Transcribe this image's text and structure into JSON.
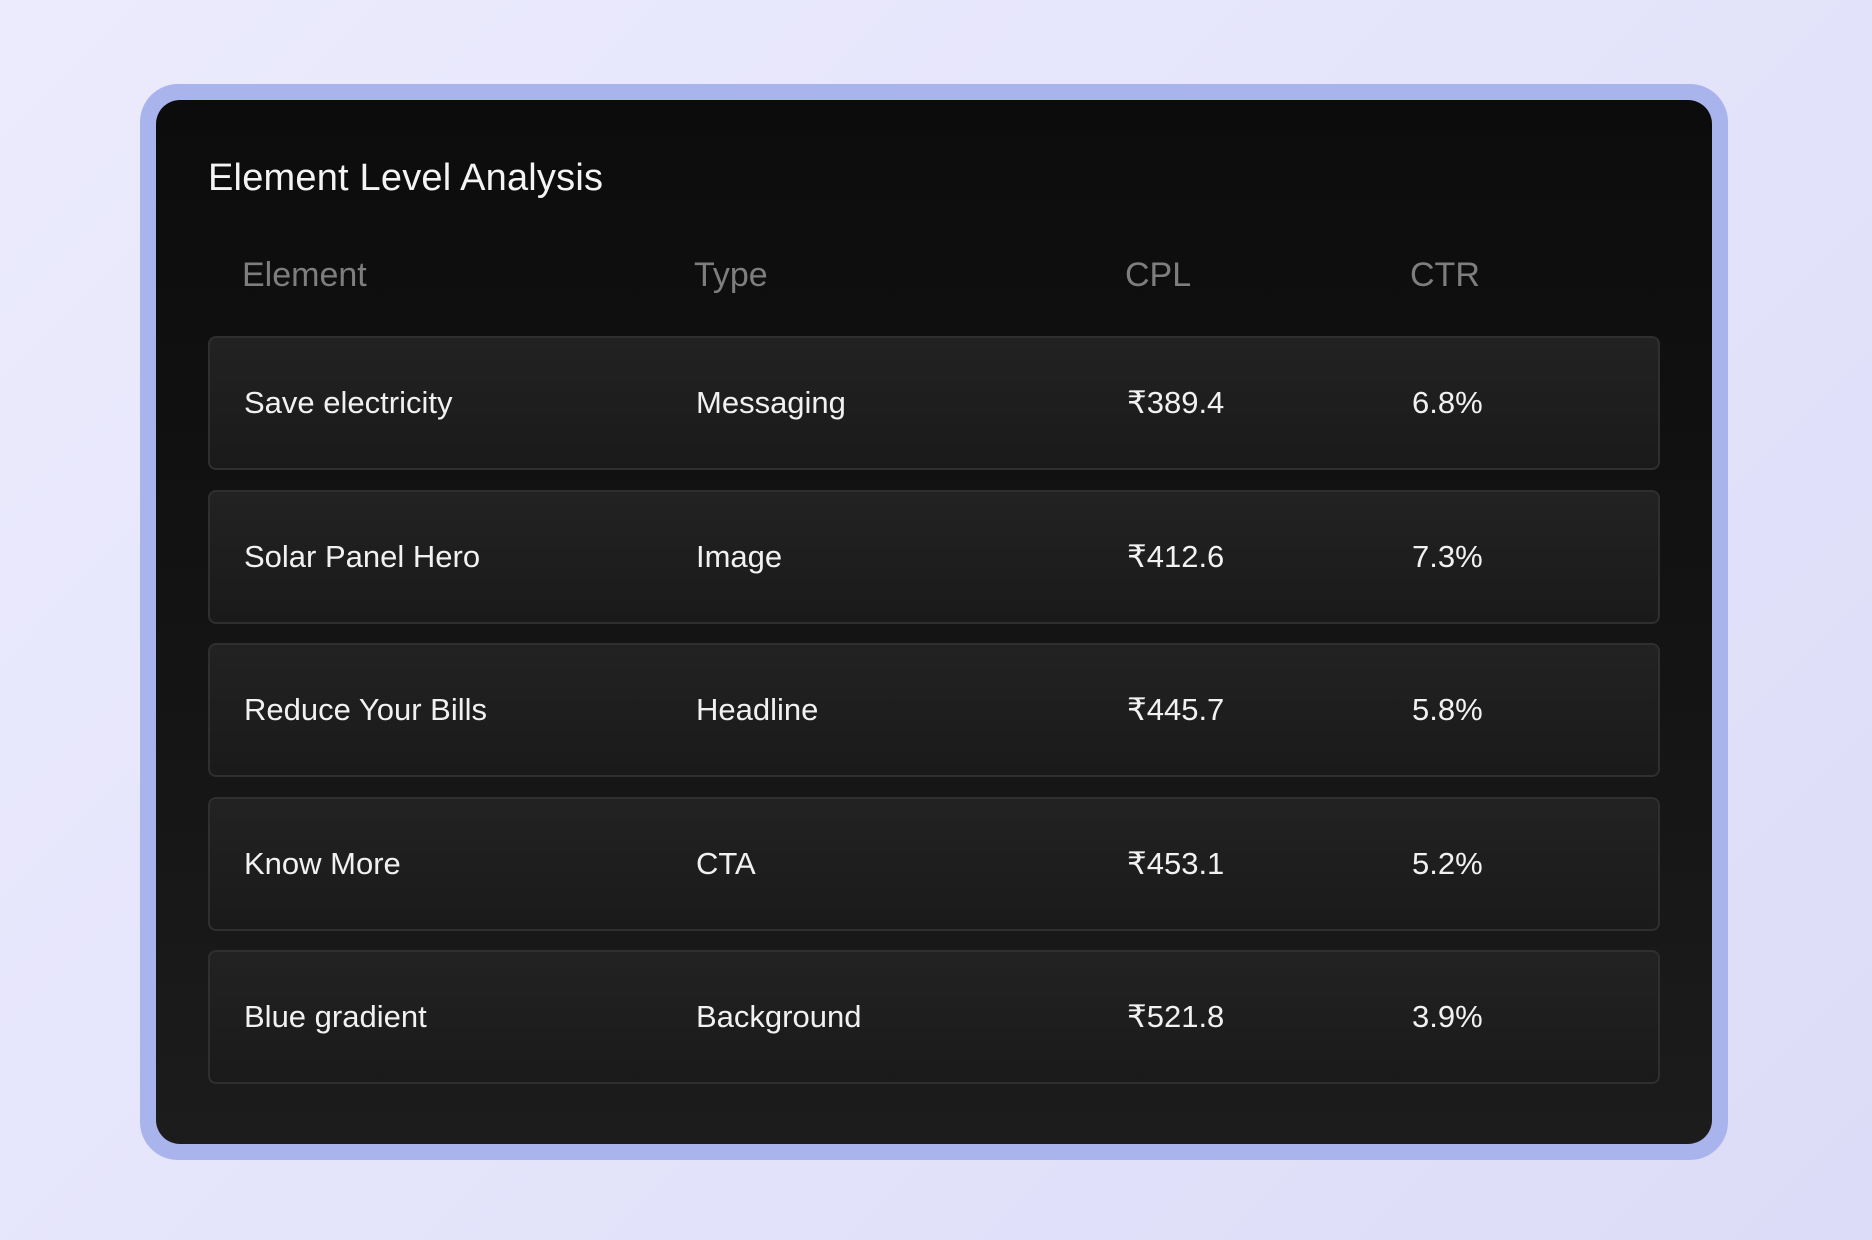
{
  "card": {
    "title": "Element Level Analysis"
  },
  "table": {
    "headers": {
      "element": "Element",
      "type": "Type",
      "cpl": "CPL",
      "ctr": "CTR"
    },
    "rows": [
      {
        "element": "Save electricity",
        "type": "Messaging",
        "cpl": "₹389.4",
        "ctr": "6.8%"
      },
      {
        "element": "Solar Panel Hero",
        "type": "Image",
        "cpl": "₹412.6",
        "ctr": "7.3%"
      },
      {
        "element": "Reduce Your Bills",
        "type": "Headline",
        "cpl": "₹445.7",
        "ctr": "5.8%"
      },
      {
        "element": "Know More",
        "type": "CTA",
        "cpl": "₹453.1",
        "ctr": "5.2%"
      },
      {
        "element": "Blue gradient",
        "type": "Background",
        "cpl": "₹521.8",
        "ctr": "3.9%"
      }
    ]
  },
  "colors": {
    "frame": "#aab4ec",
    "card": "#111111",
    "row": "#1f1f1f",
    "header_text": "#7e7e7e",
    "text": "#f1f1f1"
  }
}
